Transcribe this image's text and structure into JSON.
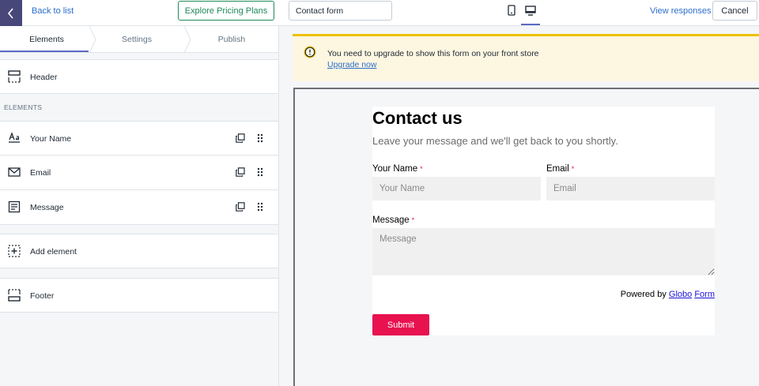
{
  "topbar": {
    "back_label": "Back to list",
    "pricing_label": "Explore Pricing Plans",
    "form_title_value": "Contact form",
    "view_responses_label": "View responses",
    "cancel_label": "Cancel"
  },
  "tabs": [
    {
      "label": "Elements",
      "active": true
    },
    {
      "label": "Settings",
      "active": false
    },
    {
      "label": "Publish",
      "active": false
    }
  ],
  "sidebar": {
    "header_item": {
      "label": "Header",
      "icon": "header-layout-icon"
    },
    "section_label": "ELEMENTS",
    "elements": [
      {
        "label": "Your Name",
        "icon": "text-field-icon"
      },
      {
        "label": "Email",
        "icon": "envelope-icon"
      },
      {
        "label": "Message",
        "icon": "paragraph-icon"
      }
    ],
    "add_element_label": "Add element",
    "footer_item": {
      "label": "Footer",
      "icon": "footer-layout-icon"
    }
  },
  "banner": {
    "text": "You need to upgrade to show this form on your front store",
    "link": "Upgrade now",
    "accent_color": "#eec200"
  },
  "form": {
    "title": "Contact us",
    "subtitle": "Leave your message and we'll get back to you shortly.",
    "name_label": "Your Name",
    "name_placeholder": "Your Name",
    "email_label": "Email",
    "email_placeholder": "Email",
    "message_label": "Message",
    "message_placeholder": "Message",
    "required_mark": "*",
    "powered_prefix": "Powered by",
    "powered_link1": "Globo",
    "powered_link2": "Form",
    "submit_label": "Submit",
    "submit_color": "#e8124f"
  },
  "colors": {
    "accent": "#5c6ac4",
    "back_button": "#47477a",
    "pricing_green": "#1f8a5b",
    "link": "#2c6ecb"
  }
}
